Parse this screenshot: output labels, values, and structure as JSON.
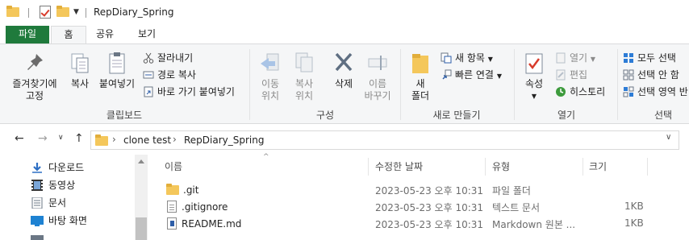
{
  "window": {
    "title": "RepDiary_Spring"
  },
  "tabs": [
    {
      "label": "파일"
    },
    {
      "label": "홈"
    },
    {
      "label": "공유"
    },
    {
      "label": "보기"
    }
  ],
  "ribbon": {
    "clipboard": {
      "pin_label": "즐겨찾기에\n고정",
      "copy_label": "복사",
      "paste_label": "붙여넣기",
      "cut_label": "잘라내기",
      "copy_path_label": "경로 복사",
      "paste_shortcut_label": "바로 가기 붙여넣기",
      "group_label": "클립보드"
    },
    "organize": {
      "move_label": "이동\n위치",
      "copyto_label": "복사\n위치",
      "delete_label": "삭제",
      "rename_label": "이름\n바꾸기",
      "group_label": "구성"
    },
    "new": {
      "new_folder_label": "새\n폴더",
      "new_item_label": "새 항목",
      "easy_access_label": "빠른 연결",
      "group_label": "새로 만들기"
    },
    "open": {
      "properties_label": "속성",
      "open_label": "열기",
      "edit_label": "편집",
      "history_label": "히스토리",
      "group_label": "열기"
    },
    "select": {
      "select_all_label": "모두 선택",
      "select_none_label": "선택 안 함",
      "invert_label": "선택 영역 반",
      "group_label": "선택"
    }
  },
  "address": {
    "crumbs": [
      "clone test",
      "RepDiary_Spring"
    ]
  },
  "navpane": {
    "items": [
      {
        "label": "다운로드",
        "icon": "download-icon"
      },
      {
        "label": "동영상",
        "icon": "video-icon"
      },
      {
        "label": "문서",
        "icon": "document-icon"
      },
      {
        "label": "바탕 화면",
        "icon": "desktop-icon"
      }
    ]
  },
  "filelist": {
    "columns": {
      "name": "이름",
      "modified": "수정한 날짜",
      "type": "유형",
      "size": "크기"
    },
    "rows": [
      {
        "name": ".git",
        "modified": "2023-05-23 오후 10:31",
        "type": "파일 폴더",
        "size": "",
        "icon": "folder-icon"
      },
      {
        "name": ".gitignore",
        "modified": "2023-05-23 오후 10:31",
        "type": "텍스트 문서",
        "size": "1KB",
        "icon": "text-file-icon"
      },
      {
        "name": "README.md",
        "modified": "2023-05-23 오후 10:31",
        "type": "Markdown 원본 ...",
        "size": "1KB",
        "icon": "markdown-file-icon"
      }
    ]
  },
  "colors": {
    "file_tab": "#1f7a3c",
    "folder": "#f4c75b",
    "ribbon_bg": "#f5f6f7"
  }
}
